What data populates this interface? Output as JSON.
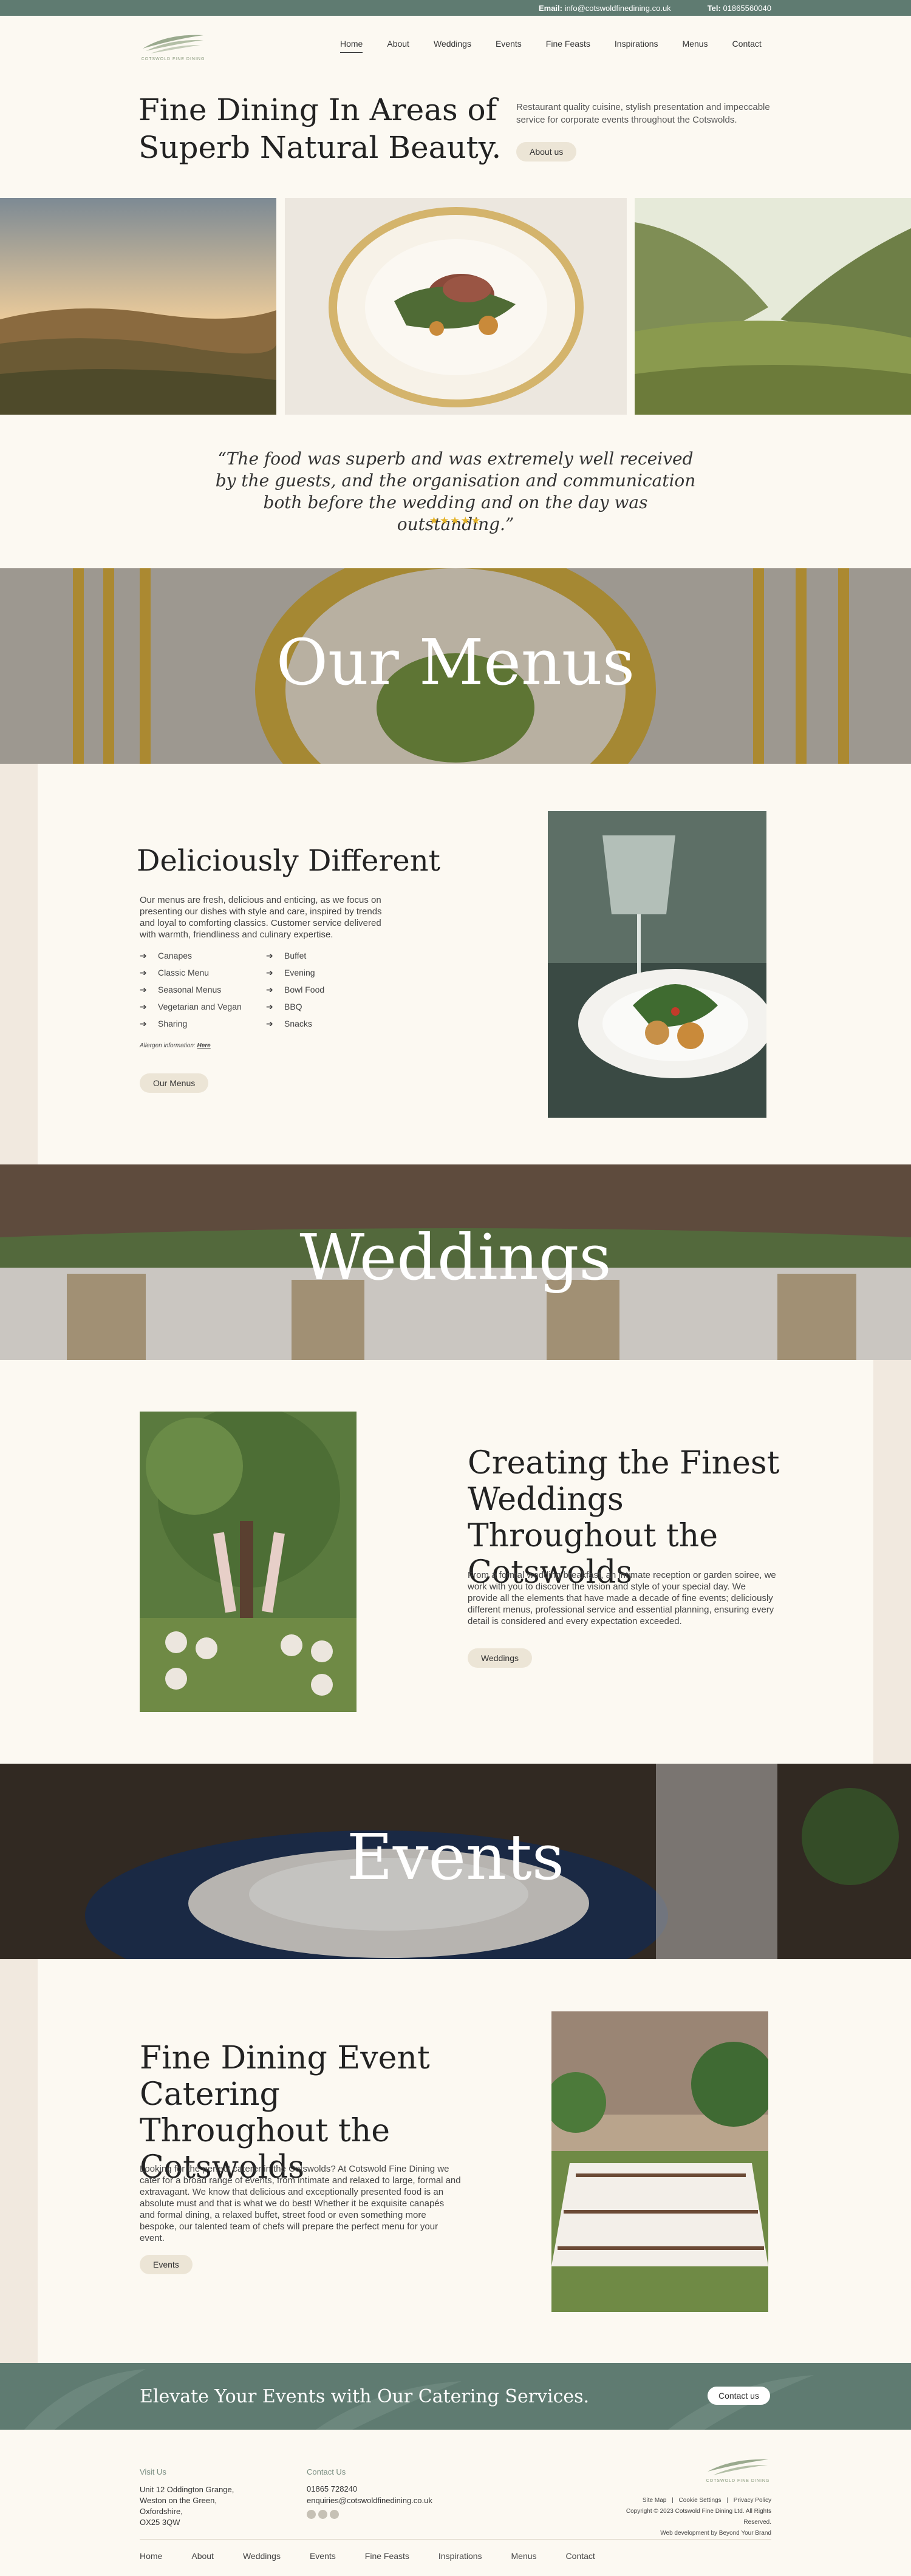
{
  "topbar": {
    "email_label": "Email:",
    "email": "info@cotswoldfinedining.co.uk",
    "tel_label": "Tel:",
    "tel": "01865560040"
  },
  "brand": {
    "logo_text": "COTSWOLD FINE DINING",
    "accent": "#5f7b71",
    "cream": "#fcf9f2",
    "button_bg": "#ece5d6",
    "star_color": "#e5b327"
  },
  "nav": {
    "items": [
      "Home",
      "About",
      "Weddings",
      "Events",
      "Fine Feasts",
      "Inspirations",
      "Menus",
      "Contact"
    ],
    "active": "Home"
  },
  "hero": {
    "title": "Fine Dining In Areas of Superb Natural Beauty.",
    "text": "Restaurant quality cuisine, stylish presentation and impeccable service for corporate events throughout the Cotswolds.",
    "button": "About us"
  },
  "testimonial": {
    "quote": "“The food was superb and was extremely well received by the guests, and the organisation and communication both before the wedding and on the day was outstanding.”",
    "stars": "★★★★★",
    "rating": 5
  },
  "menus": {
    "banner": "Our Menus",
    "title": "Deliciously Different",
    "text": "Our menus are fresh, delicious and enticing, as we focus on presenting our dishes with style and care, inspired by trends and loyal to comforting classics. Customer service delivered with warmth, friendliness and culinary expertise.",
    "list_left": [
      "Canapes",
      "Classic Menu",
      "Seasonal Menus",
      "Vegetarian and Vegan",
      "Sharing"
    ],
    "list_right": [
      "Buffet",
      "Evening",
      "Bowl Food",
      "BBQ",
      "Snacks"
    ],
    "allergen_label": "Allergen information:",
    "allergen_link": "Here",
    "button": "Our Menus"
  },
  "weddings": {
    "banner": "Weddings",
    "title": "Creating the Finest Weddings Throughout the Cotswolds",
    "text": "From a formal wedding breakfast, an intimate reception or garden soiree, we work with you to discover the vision and style of your special day. We provide all the elements that have made a decade of fine events; deliciously different menus, professional service and essential planning, ensuring every detail is considered and every expectation exceeded.",
    "button": "Weddings"
  },
  "events": {
    "banner": "Events",
    "title": "Fine Dining Event Catering Throughout the Cotswolds",
    "text": "Looking for the perfect caterer in the Cotswolds? At Cotswold Fine Dining we cater for a broad range of events, from intimate and relaxed to large, formal and extravagant. We know that delicious and exceptionally presented food is an absolute must and that is what we do best! Whether it be exquisite canapés and formal dining, a relaxed buffet, street food or even something more bespoke, our talented team of chefs will prepare the perfect menu for your event.",
    "button": "Events"
  },
  "cta": {
    "text": "Elevate Your Events with Our Catering Services.",
    "button": "Contact us"
  },
  "footer": {
    "visit_title": "Visit Us",
    "address": [
      "Unit 12 Oddington Grange,",
      "Weston on the Green,",
      "Oxfordshire,",
      "OX25 3QW"
    ],
    "contact_title": "Contact Us",
    "phone": "01865 728240",
    "email": "enquiries@cotswoldfinedining.co.uk",
    "social": [
      "facebook-icon",
      "instagram-icon",
      "linkedin-icon"
    ],
    "links": [
      "Site Map",
      "Cookie Settings",
      "Privacy Policy"
    ],
    "copyright": "Copyright © 2023 Cotswold Fine Dining Ltd. All Rights Reserved.",
    "credit": "Web development by Beyond Your Brand",
    "nav": [
      "Home",
      "About",
      "Weddings",
      "Events",
      "Fine Feasts",
      "Inspirations",
      "Menus",
      "Contact"
    ]
  }
}
